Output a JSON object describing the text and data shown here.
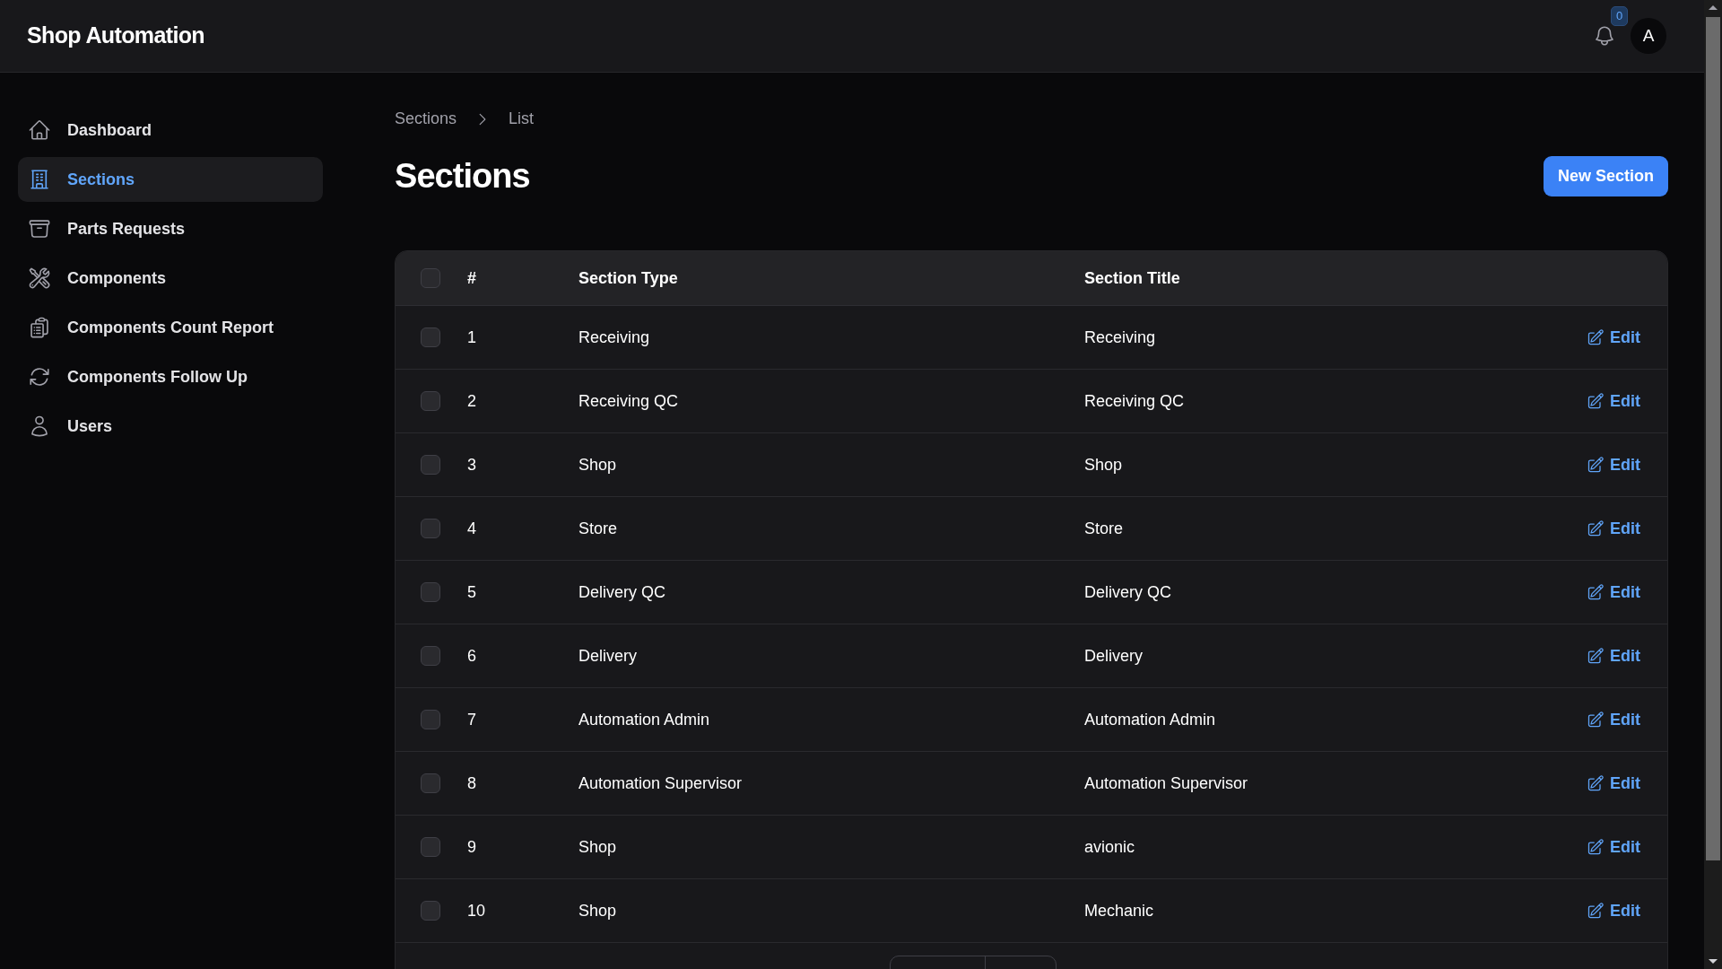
{
  "app_title": "Shop Automation",
  "notifications": {
    "count": "0"
  },
  "avatar": {
    "initial": "A"
  },
  "sidebar": {
    "items": [
      {
        "label": "Dashboard",
        "selected": false
      },
      {
        "label": "Sections",
        "selected": true
      },
      {
        "label": "Parts Requests",
        "selected": false
      },
      {
        "label": "Components",
        "selected": false
      },
      {
        "label": "Components Count Report",
        "selected": false
      },
      {
        "label": "Components Follow Up",
        "selected": false
      },
      {
        "label": "Users",
        "selected": false
      }
    ]
  },
  "breadcrumbs": [
    "Sections",
    "List"
  ],
  "page_title": "Sections",
  "new_button": "New Section",
  "table": {
    "select_all_checked": false,
    "columns": [
      "#",
      "Section Type",
      "Section Title"
    ],
    "rows": [
      {
        "id": "1",
        "type": "Receiving",
        "title": "Receiving",
        "action": "Edit",
        "checked": false
      },
      {
        "id": "2",
        "type": "Receiving QC",
        "title": "Receiving QC",
        "action": "Edit",
        "checked": false
      },
      {
        "id": "3",
        "type": "Shop",
        "title": "Shop",
        "action": "Edit",
        "checked": false
      },
      {
        "id": "4",
        "type": "Store",
        "title": "Store",
        "action": "Edit",
        "checked": false
      },
      {
        "id": "5",
        "type": "Delivery QC",
        "title": "Delivery QC",
        "action": "Edit",
        "checked": false
      },
      {
        "id": "6",
        "type": "Delivery",
        "title": "Delivery",
        "action": "Edit",
        "checked": false
      },
      {
        "id": "7",
        "type": "Automation Admin",
        "title": "Automation Admin",
        "action": "Edit",
        "checked": false
      },
      {
        "id": "8",
        "type": "Automation Supervisor",
        "title": "Automation Supervisor",
        "action": "Edit",
        "checked": false
      },
      {
        "id": "9",
        "type": "Shop",
        "title": "avionic",
        "action": "Edit",
        "checked": false
      },
      {
        "id": "10",
        "type": "Shop",
        "title": "Mechanic",
        "action": "Edit",
        "checked": false
      }
    ]
  }
}
